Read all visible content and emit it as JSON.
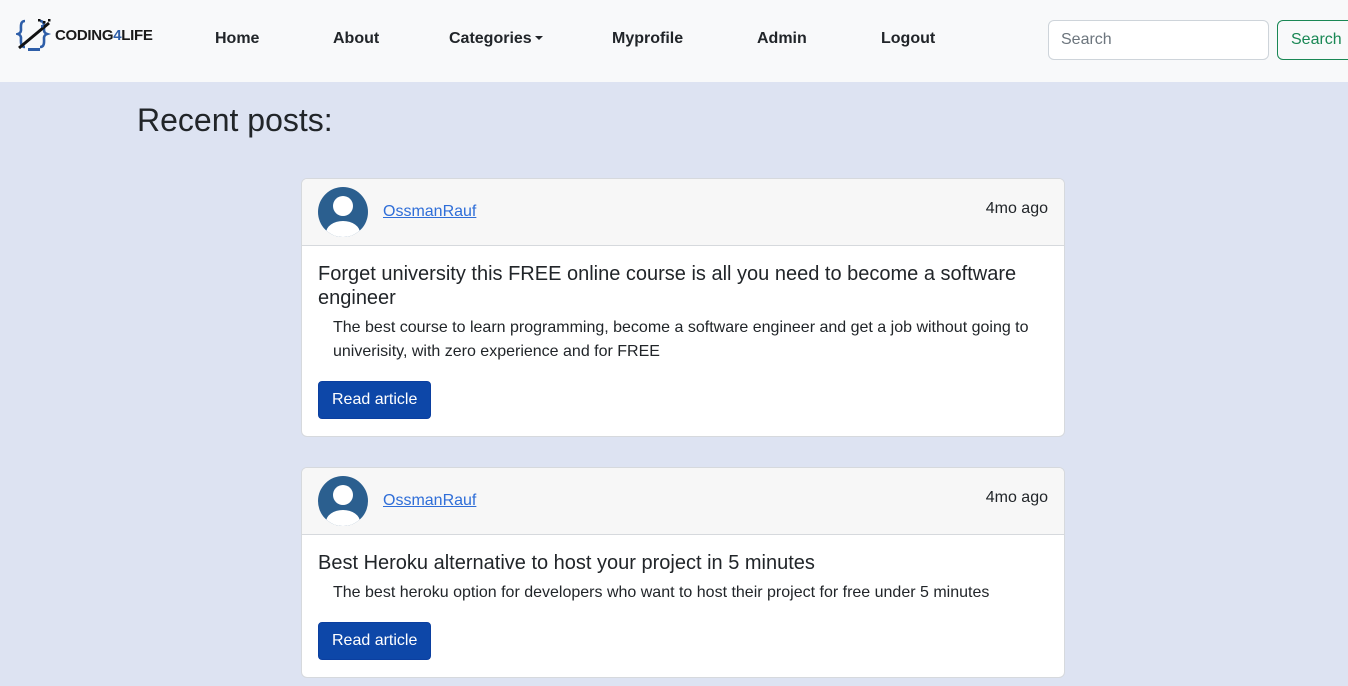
{
  "brand": {
    "name_prefix": "CODING",
    "name_number": "4",
    "name_suffix": "LIFE",
    "logo_icon": "code-braces-monitor-icon"
  },
  "nav": {
    "home": "Home",
    "about": "About",
    "categories": "Categories",
    "myprofile": "Myprofile",
    "admin": "Admin",
    "logout": "Logout"
  },
  "search": {
    "placeholder": "Search",
    "button_label": "Search"
  },
  "page": {
    "heading": "Recent posts:"
  },
  "posts": [
    {
      "author": "OssmanRauf",
      "time": "4mo ago",
      "title": "Forget university this FREE online course is all you need to become a software engineer",
      "excerpt": "The best course to learn programming, become a software engineer and get a job without going to univerisity, with zero experience and for FREE",
      "button_label": "Read article"
    },
    {
      "author": "OssmanRauf",
      "time": "4mo ago",
      "title": "Best Heroku alternative to host your project in 5 minutes",
      "excerpt": "The best heroku option for developers who want to host their project for free under 5 minutes",
      "button_label": "Read article"
    }
  ],
  "colors": {
    "page_bg": "#dde3f2",
    "primary_button": "#0d47a8",
    "link": "#2f6ed8",
    "success": "#198754",
    "avatar": "#2b5f8f"
  }
}
